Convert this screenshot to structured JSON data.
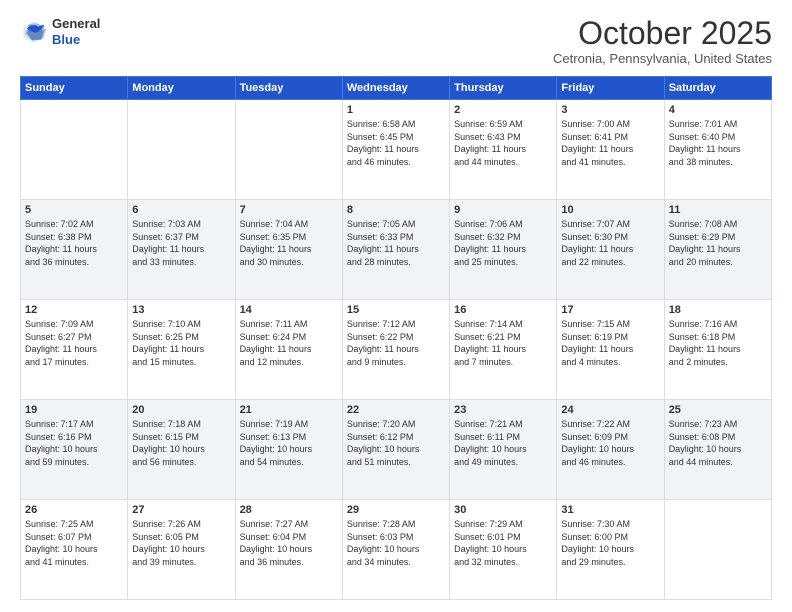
{
  "header": {
    "logo_general": "General",
    "logo_blue": "Blue",
    "month_title": "October 2025",
    "location": "Cetronia, Pennsylvania, United States"
  },
  "days_of_week": [
    "Sunday",
    "Monday",
    "Tuesday",
    "Wednesday",
    "Thursday",
    "Friday",
    "Saturday"
  ],
  "weeks": [
    [
      {
        "day": "",
        "info": ""
      },
      {
        "day": "",
        "info": ""
      },
      {
        "day": "",
        "info": ""
      },
      {
        "day": "1",
        "info": "Sunrise: 6:58 AM\nSunset: 6:45 PM\nDaylight: 11 hours\nand 46 minutes."
      },
      {
        "day": "2",
        "info": "Sunrise: 6:59 AM\nSunset: 6:43 PM\nDaylight: 11 hours\nand 44 minutes."
      },
      {
        "day": "3",
        "info": "Sunrise: 7:00 AM\nSunset: 6:41 PM\nDaylight: 11 hours\nand 41 minutes."
      },
      {
        "day": "4",
        "info": "Sunrise: 7:01 AM\nSunset: 6:40 PM\nDaylight: 11 hours\nand 38 minutes."
      }
    ],
    [
      {
        "day": "5",
        "info": "Sunrise: 7:02 AM\nSunset: 6:38 PM\nDaylight: 11 hours\nand 36 minutes."
      },
      {
        "day": "6",
        "info": "Sunrise: 7:03 AM\nSunset: 6:37 PM\nDaylight: 11 hours\nand 33 minutes."
      },
      {
        "day": "7",
        "info": "Sunrise: 7:04 AM\nSunset: 6:35 PM\nDaylight: 11 hours\nand 30 minutes."
      },
      {
        "day": "8",
        "info": "Sunrise: 7:05 AM\nSunset: 6:33 PM\nDaylight: 11 hours\nand 28 minutes."
      },
      {
        "day": "9",
        "info": "Sunrise: 7:06 AM\nSunset: 6:32 PM\nDaylight: 11 hours\nand 25 minutes."
      },
      {
        "day": "10",
        "info": "Sunrise: 7:07 AM\nSunset: 6:30 PM\nDaylight: 11 hours\nand 22 minutes."
      },
      {
        "day": "11",
        "info": "Sunrise: 7:08 AM\nSunset: 6:29 PM\nDaylight: 11 hours\nand 20 minutes."
      }
    ],
    [
      {
        "day": "12",
        "info": "Sunrise: 7:09 AM\nSunset: 6:27 PM\nDaylight: 11 hours\nand 17 minutes."
      },
      {
        "day": "13",
        "info": "Sunrise: 7:10 AM\nSunset: 6:25 PM\nDaylight: 11 hours\nand 15 minutes."
      },
      {
        "day": "14",
        "info": "Sunrise: 7:11 AM\nSunset: 6:24 PM\nDaylight: 11 hours\nand 12 minutes."
      },
      {
        "day": "15",
        "info": "Sunrise: 7:12 AM\nSunset: 6:22 PM\nDaylight: 11 hours\nand 9 minutes."
      },
      {
        "day": "16",
        "info": "Sunrise: 7:14 AM\nSunset: 6:21 PM\nDaylight: 11 hours\nand 7 minutes."
      },
      {
        "day": "17",
        "info": "Sunrise: 7:15 AM\nSunset: 6:19 PM\nDaylight: 11 hours\nand 4 minutes."
      },
      {
        "day": "18",
        "info": "Sunrise: 7:16 AM\nSunset: 6:18 PM\nDaylight: 11 hours\nand 2 minutes."
      }
    ],
    [
      {
        "day": "19",
        "info": "Sunrise: 7:17 AM\nSunset: 6:16 PM\nDaylight: 10 hours\nand 59 minutes."
      },
      {
        "day": "20",
        "info": "Sunrise: 7:18 AM\nSunset: 6:15 PM\nDaylight: 10 hours\nand 56 minutes."
      },
      {
        "day": "21",
        "info": "Sunrise: 7:19 AM\nSunset: 6:13 PM\nDaylight: 10 hours\nand 54 minutes."
      },
      {
        "day": "22",
        "info": "Sunrise: 7:20 AM\nSunset: 6:12 PM\nDaylight: 10 hours\nand 51 minutes."
      },
      {
        "day": "23",
        "info": "Sunrise: 7:21 AM\nSunset: 6:11 PM\nDaylight: 10 hours\nand 49 minutes."
      },
      {
        "day": "24",
        "info": "Sunrise: 7:22 AM\nSunset: 6:09 PM\nDaylight: 10 hours\nand 46 minutes."
      },
      {
        "day": "25",
        "info": "Sunrise: 7:23 AM\nSunset: 6:08 PM\nDaylight: 10 hours\nand 44 minutes."
      }
    ],
    [
      {
        "day": "26",
        "info": "Sunrise: 7:25 AM\nSunset: 6:07 PM\nDaylight: 10 hours\nand 41 minutes."
      },
      {
        "day": "27",
        "info": "Sunrise: 7:26 AM\nSunset: 6:05 PM\nDaylight: 10 hours\nand 39 minutes."
      },
      {
        "day": "28",
        "info": "Sunrise: 7:27 AM\nSunset: 6:04 PM\nDaylight: 10 hours\nand 36 minutes."
      },
      {
        "day": "29",
        "info": "Sunrise: 7:28 AM\nSunset: 6:03 PM\nDaylight: 10 hours\nand 34 minutes."
      },
      {
        "day": "30",
        "info": "Sunrise: 7:29 AM\nSunset: 6:01 PM\nDaylight: 10 hours\nand 32 minutes."
      },
      {
        "day": "31",
        "info": "Sunrise: 7:30 AM\nSunset: 6:00 PM\nDaylight: 10 hours\nand 29 minutes."
      },
      {
        "day": "",
        "info": ""
      }
    ]
  ]
}
